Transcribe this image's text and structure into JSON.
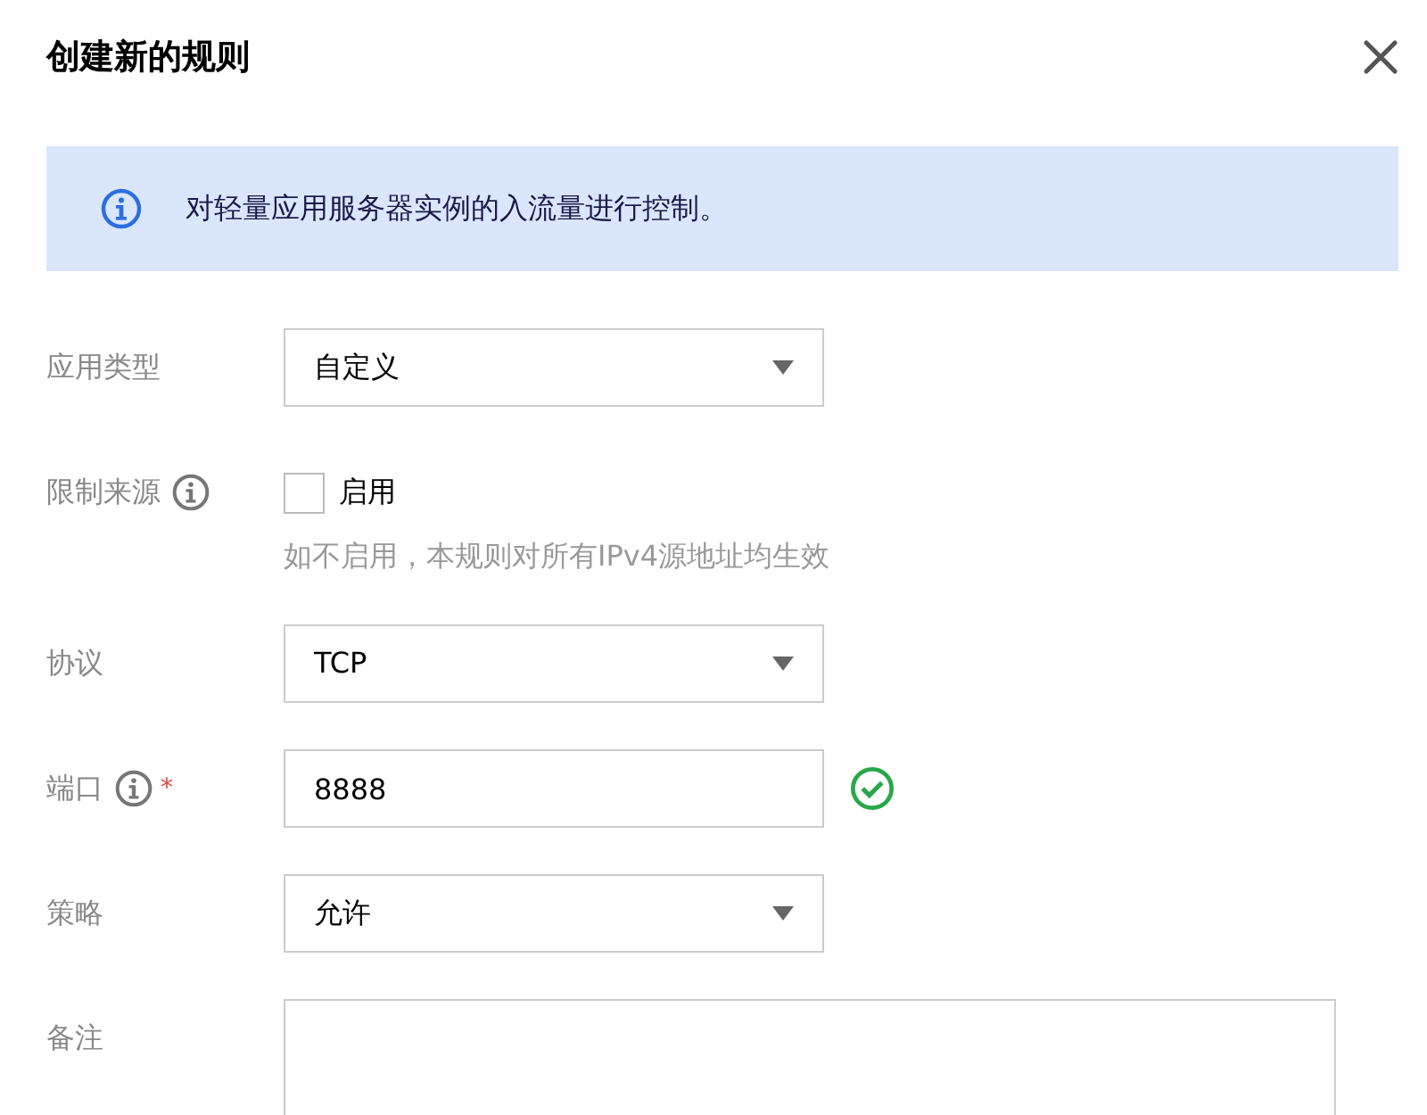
{
  "dialog": {
    "title": "创建新的规则"
  },
  "notice": {
    "text": "对轻量应用服务器实例的入流量进行控制。"
  },
  "fields": [
    {
      "kind": "select",
      "label": "应用类型",
      "value": "自定义"
    },
    {
      "kind": "checkbox",
      "label": "限制来源",
      "info": true,
      "option": "启用",
      "checked": false,
      "hint": "如不启用，本规则对所有IPv4源地址均生效"
    },
    {
      "kind": "select",
      "label": "协议",
      "value": "TCP"
    },
    {
      "kind": "input",
      "label": "端口",
      "info": true,
      "required_mark": "*",
      "value": "8888",
      "valid": true
    },
    {
      "kind": "select",
      "label": "策略",
      "value": "允许"
    },
    {
      "kind": "textarea",
      "label": "备注"
    }
  ]
}
